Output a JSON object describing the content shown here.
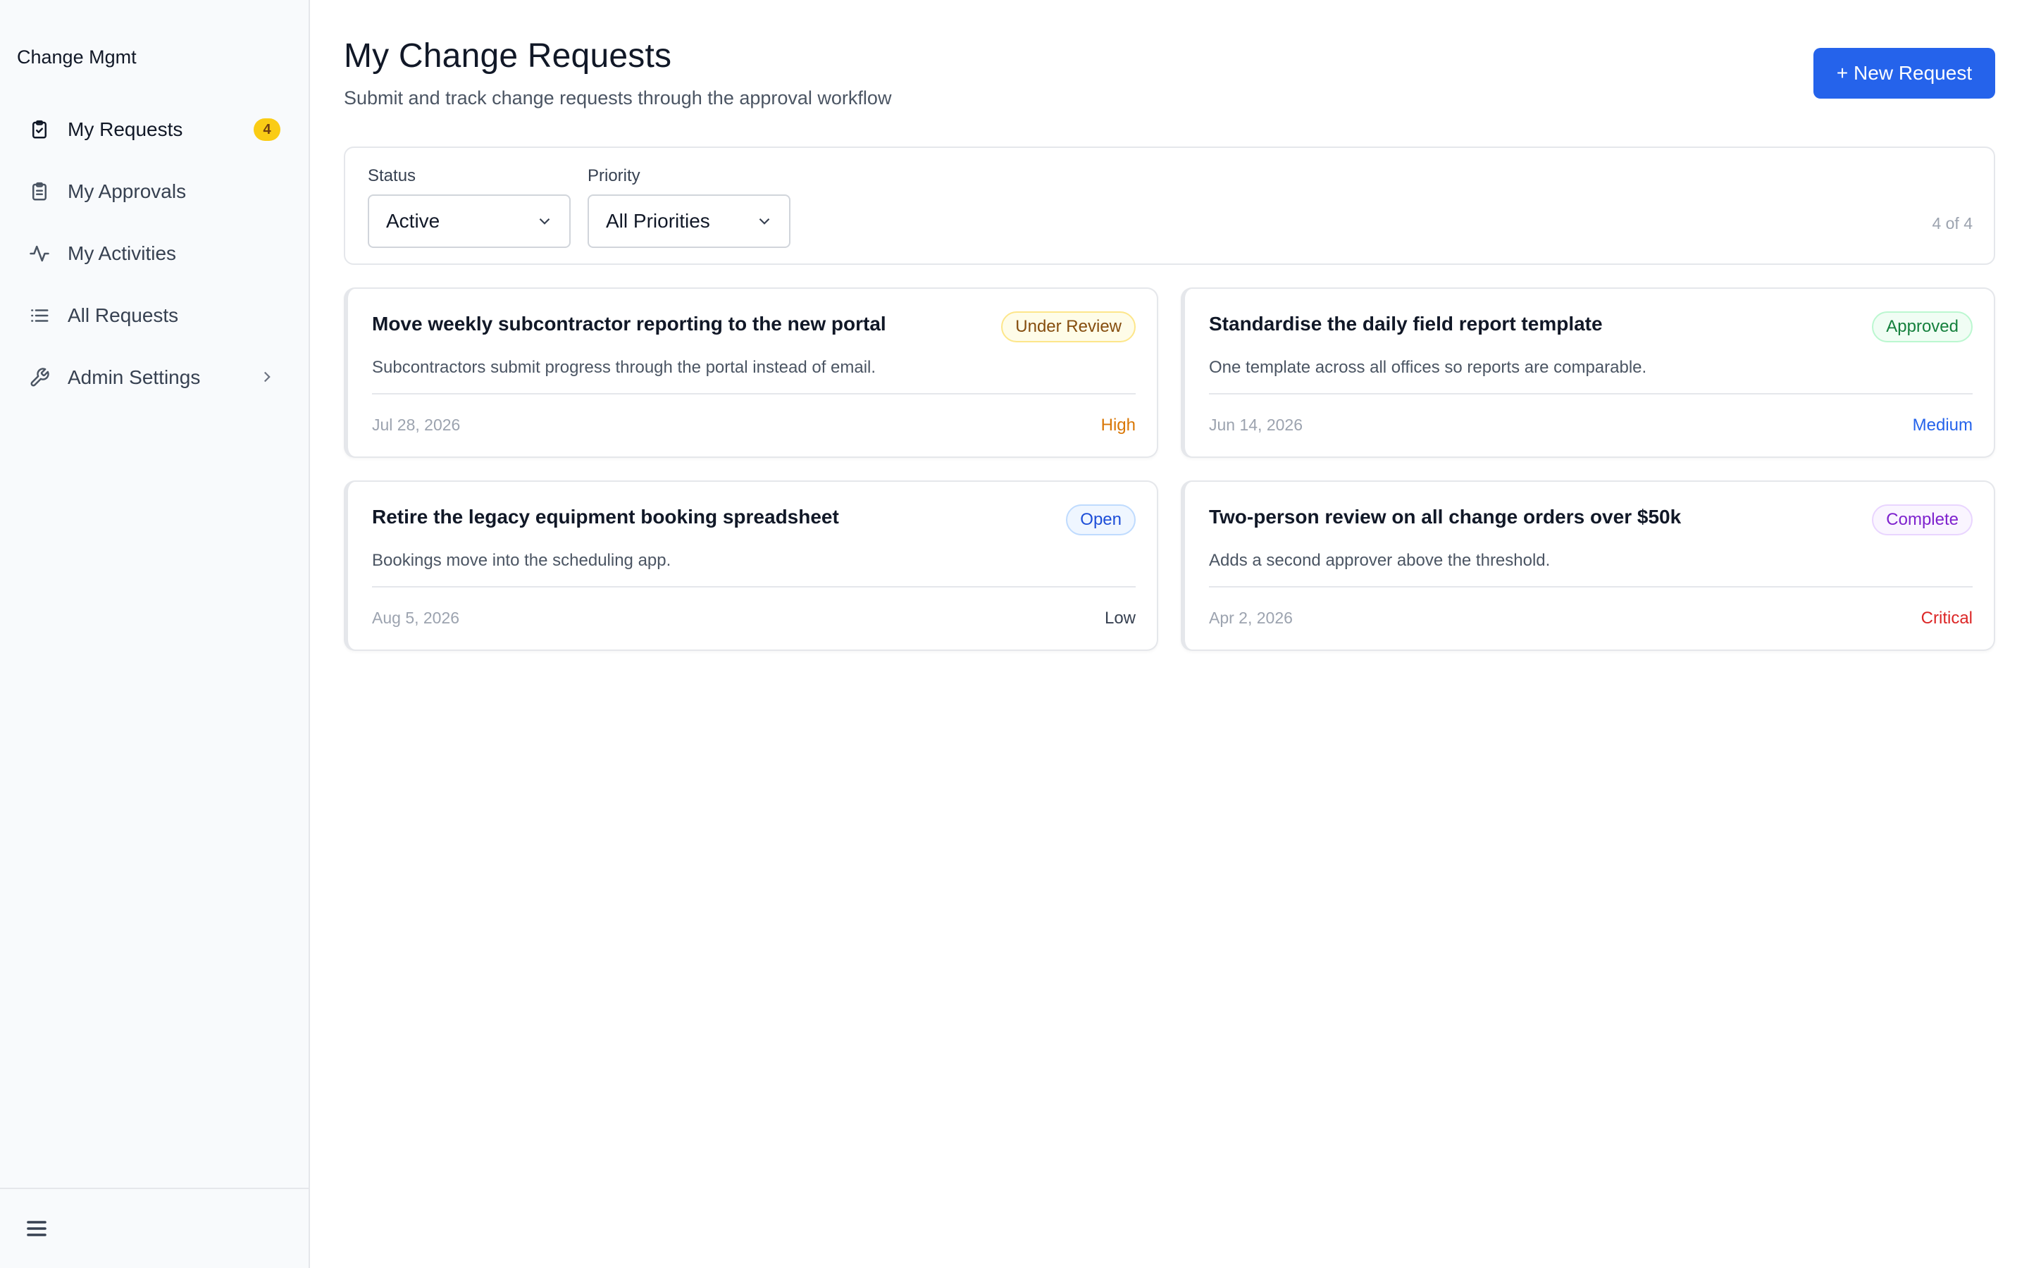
{
  "app": {
    "brand": "Change Mgmt"
  },
  "sidebar": {
    "items": [
      {
        "label": "My Requests",
        "icon": "clipboard-check-icon",
        "badge": "4",
        "active": true
      },
      {
        "label": "My Approvals",
        "icon": "clipboard-list-icon"
      },
      {
        "label": "My Activities",
        "icon": "activity-icon"
      },
      {
        "label": "All Requests",
        "icon": "list-icon"
      },
      {
        "label": "Admin Settings",
        "icon": "wrench-icon",
        "expandable": true
      }
    ],
    "footer_icon": "menu-icon"
  },
  "header": {
    "title": "My Change Requests",
    "subtitle": "Submit and track change requests through the approval workflow",
    "new_button": "+ New Request"
  },
  "filters": {
    "status_label": "Status",
    "status_value": "Active",
    "priority_label": "Priority",
    "priority_value": "All Priorities",
    "count": "4 of 4"
  },
  "requests": [
    {
      "title": "Move weekly subcontractor reporting to the new portal",
      "description": "Subcontractors submit progress through the portal instead of email.",
      "status": "Under Review",
      "date": "Jul 28, 2026",
      "priority": "High"
    },
    {
      "title": "Standardise the daily field report template",
      "description": "One template across all offices so reports are comparable.",
      "status": "Approved",
      "date": "Jun 14, 2026",
      "priority": "Medium"
    },
    {
      "title": "Retire the legacy equipment booking spreadsheet",
      "description": "Bookings move into the scheduling app.",
      "status": "Open",
      "date": "Aug 5, 2026",
      "priority": "Low"
    },
    {
      "title": "Two-person review on all change orders over $50k",
      "description": "Adds a second approver above the threshold.",
      "status": "Complete",
      "date": "Apr 2, 2026",
      "priority": "Critical"
    }
  ],
  "colors": {
    "accent": "#2563eb",
    "badge": "#facc15",
    "status_under_review": "#854d0e",
    "status_approved": "#15803d",
    "status_open": "#1d4ed8",
    "status_complete": "#7e22ce",
    "priority_high": "#d97706",
    "priority_medium": "#2563eb",
    "priority_low": "#374151",
    "priority_critical": "#dc2626"
  }
}
